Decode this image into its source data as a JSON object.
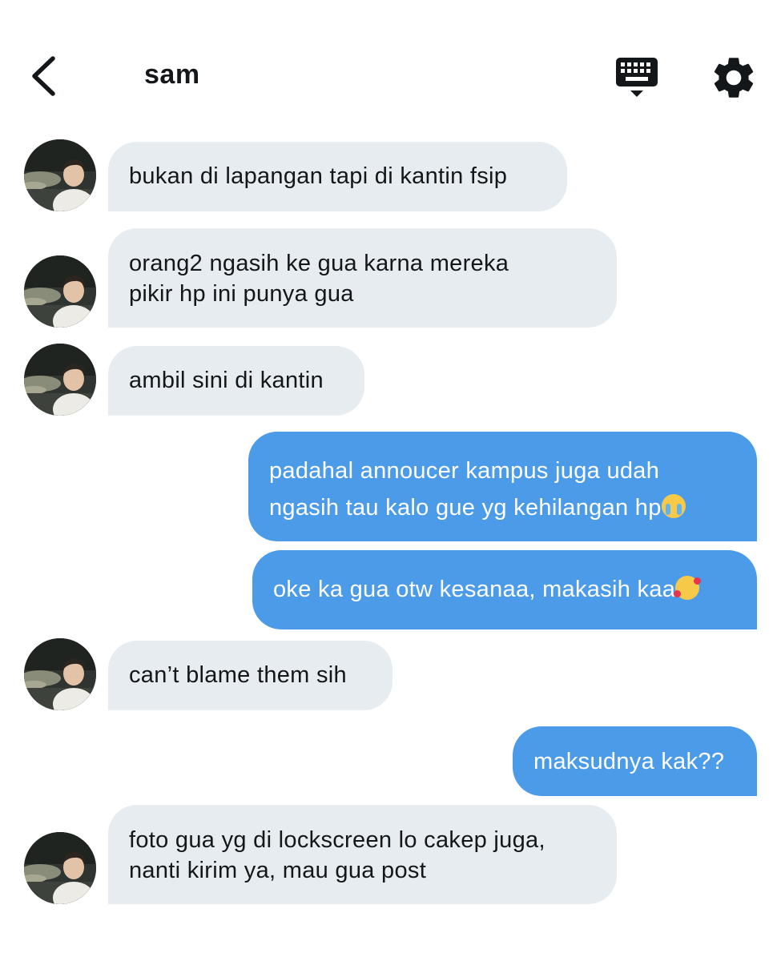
{
  "header": {
    "title": "sam",
    "back_icon": "chevron-left-icon",
    "keyboard_icon": "keyboard-icon",
    "settings_icon": "gear-icon"
  },
  "colors": {
    "incoming_bubble": "#e6ecf0",
    "outgoing_bubble": "#4b9be9",
    "incoming_text": "#14171a",
    "outgoing_text": "#ffffff"
  },
  "messages": [
    {
      "direction": "incoming",
      "lines": [
        "bukan di lapangan tapi di kantin fsip"
      ]
    },
    {
      "direction": "incoming",
      "lines": [
        "orang2 ngasih ke gua karna mereka",
        "pikir hp ini punya gua"
      ]
    },
    {
      "direction": "incoming",
      "lines": [
        "ambil sini di kantin"
      ]
    },
    {
      "direction": "outgoing",
      "lines": [
        "padahal annoucer kampus juga udah",
        "ngasih tau kalo gue yg kehilangan hp"
      ],
      "emoji": "loudly-crying-face"
    },
    {
      "direction": "outgoing",
      "lines": [
        "oke ka gua otw kesanaa, makasih kaa"
      ],
      "emoji": "smiling-face-with-hearts"
    },
    {
      "direction": "incoming",
      "lines": [
        "can’t blame them sih"
      ]
    },
    {
      "direction": "outgoing",
      "lines": [
        "maksudnya kak??"
      ]
    },
    {
      "direction": "incoming",
      "lines": [
        "foto gua yg di lockscreen lo cakep juga,",
        "nanti kirim ya, mau gua post"
      ]
    }
  ]
}
